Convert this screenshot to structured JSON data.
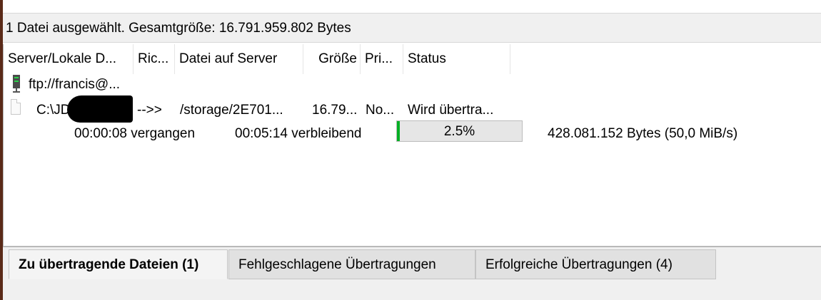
{
  "status_bar": {
    "text": "1 Datei ausgewählt. Gesamtgröße: 16.791.959.802 Bytes"
  },
  "columns": [
    "Server/Lokale D...",
    "Ric...",
    "Datei auf Server",
    "Größe",
    "Pri...",
    "Status"
  ],
  "server_row": {
    "icon": "server-icon",
    "label": "ftp://francis@..."
  },
  "file_row": {
    "icon": "file-icon",
    "local_path": "C:\\JD",
    "direction": "-->>",
    "remote_file": "/storage/2E701...",
    "size": "16.79...",
    "priority": "No...",
    "status": "Wird übertra..."
  },
  "progress_row": {
    "elapsed": "00:00:08 vergangen",
    "remaining": "00:05:14 verbleibend",
    "percent_label": "2.5%",
    "percent_value": 2.5,
    "rate": "428.081.152 Bytes (50,0 MiB/s)"
  },
  "tabs": [
    {
      "label": "Zu übertragende Dateien (1)",
      "active": true
    },
    {
      "label": "Fehlgeschlagene Übertragungen",
      "active": false
    },
    {
      "label": "Erfolgreiche Übertragungen (4)",
      "active": false
    }
  ],
  "colors": {
    "progress": "#06b025",
    "chrome": "#f0f0f0"
  }
}
